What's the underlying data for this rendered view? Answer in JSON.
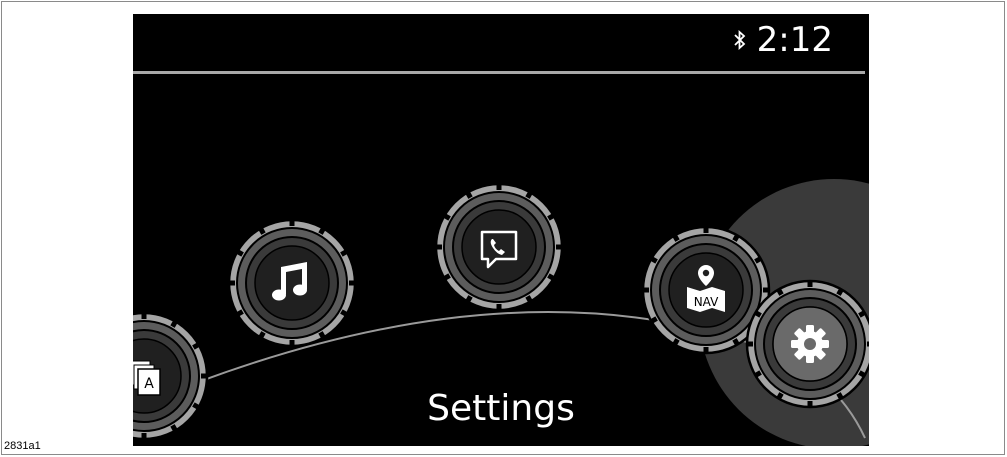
{
  "status": {
    "time": "2:12",
    "bluetooth_icon": "bluetooth-icon"
  },
  "caption": {
    "label": "Settings"
  },
  "menu": {
    "items": [
      {
        "id": "entertainment",
        "icon": "app-list-icon",
        "glyph": "A"
      },
      {
        "id": "music",
        "icon": "music-note-icon"
      },
      {
        "id": "communication",
        "icon": "message-phone-icon"
      },
      {
        "id": "navigation",
        "icon": "nav-map-icon",
        "glyph": "NAV"
      },
      {
        "id": "settings",
        "icon": "gear-icon",
        "selected": true
      }
    ]
  },
  "figure": {
    "ref": "2831a1"
  },
  "colors": {
    "screen": "#000000",
    "ring": "#a5a5a5",
    "selected_halo": "#3a3a3a",
    "text": "#ffffff"
  }
}
